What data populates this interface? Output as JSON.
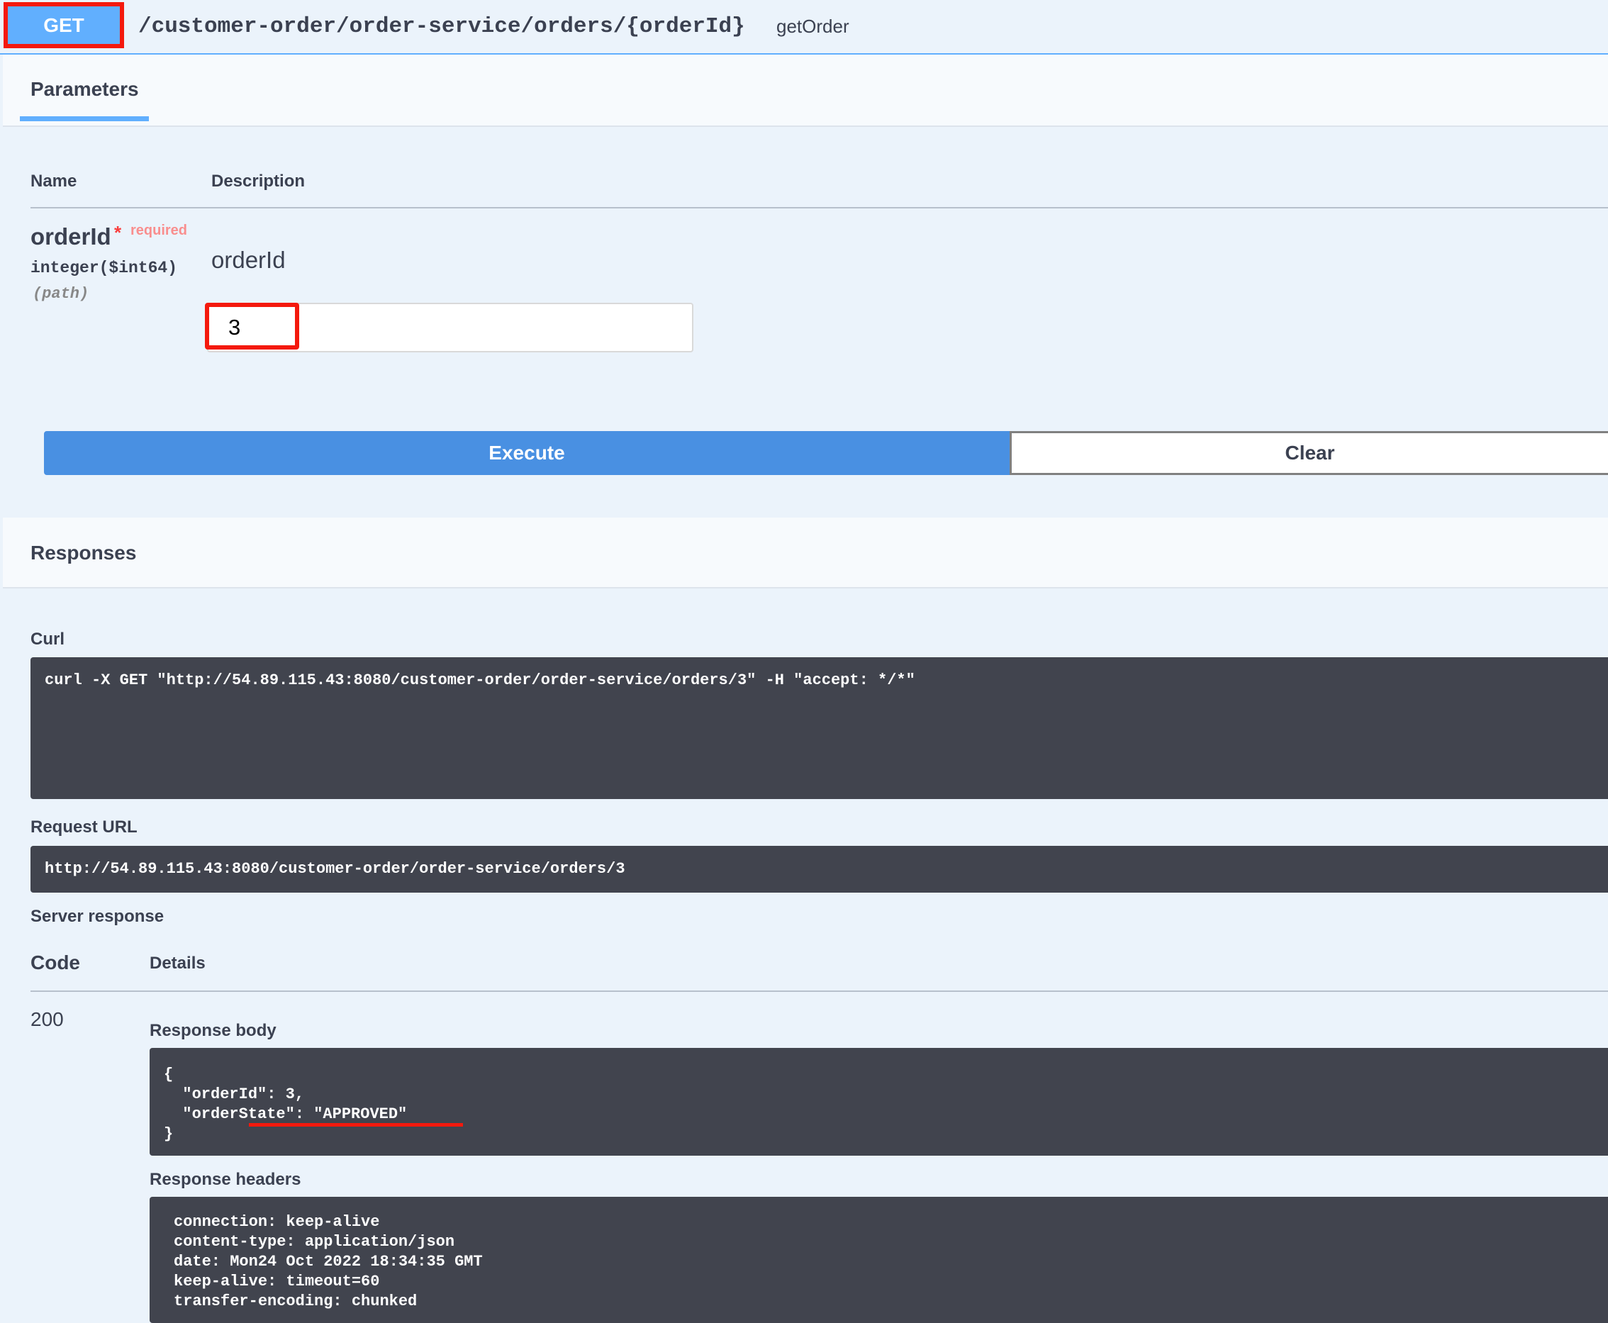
{
  "header": {
    "method": "GET",
    "path": "/customer-order/order-service/orders/{orderId}",
    "operation_id": "getOrder"
  },
  "parameters": {
    "tab_label": "Parameters",
    "col_name": "Name",
    "col_description": "Description",
    "param": {
      "name": "orderId",
      "required_star": "*",
      "required_label": "required",
      "type": "integer($int64)",
      "location": "(path)",
      "description": "orderId",
      "value": "3"
    }
  },
  "buttons": {
    "execute": "Execute",
    "clear": "Clear"
  },
  "responses": {
    "title": "Responses",
    "curl_label": "Curl",
    "curl_command": "curl -X GET \"http://54.89.115.43:8080/customer-order/order-service/orders/3\" -H \"accept: */*\"",
    "request_url_label": "Request URL",
    "request_url": "http://54.89.115.43:8080/customer-order/order-service/orders/3",
    "server_response_label": "Server response",
    "col_code": "Code",
    "col_details": "Details",
    "status_code": "200",
    "response_body_label": "Response body",
    "response_body": "{\n  \"orderId\": 3,\n  \"orderState\": \"APPROVED\"\n}",
    "response_headers_label": "Response headers",
    "response_headers": "connection: keep-alive\ncontent-type: application/json\ndate: Mon24 Oct 2022 18:34:35 GMT\nkeep-alive: timeout=60\ntransfer-encoding: chunked"
  },
  "colors": {
    "method_get": "#61affe",
    "execute": "#4990e2",
    "highlight": "#f4190d",
    "code_bg": "#41444e"
  }
}
